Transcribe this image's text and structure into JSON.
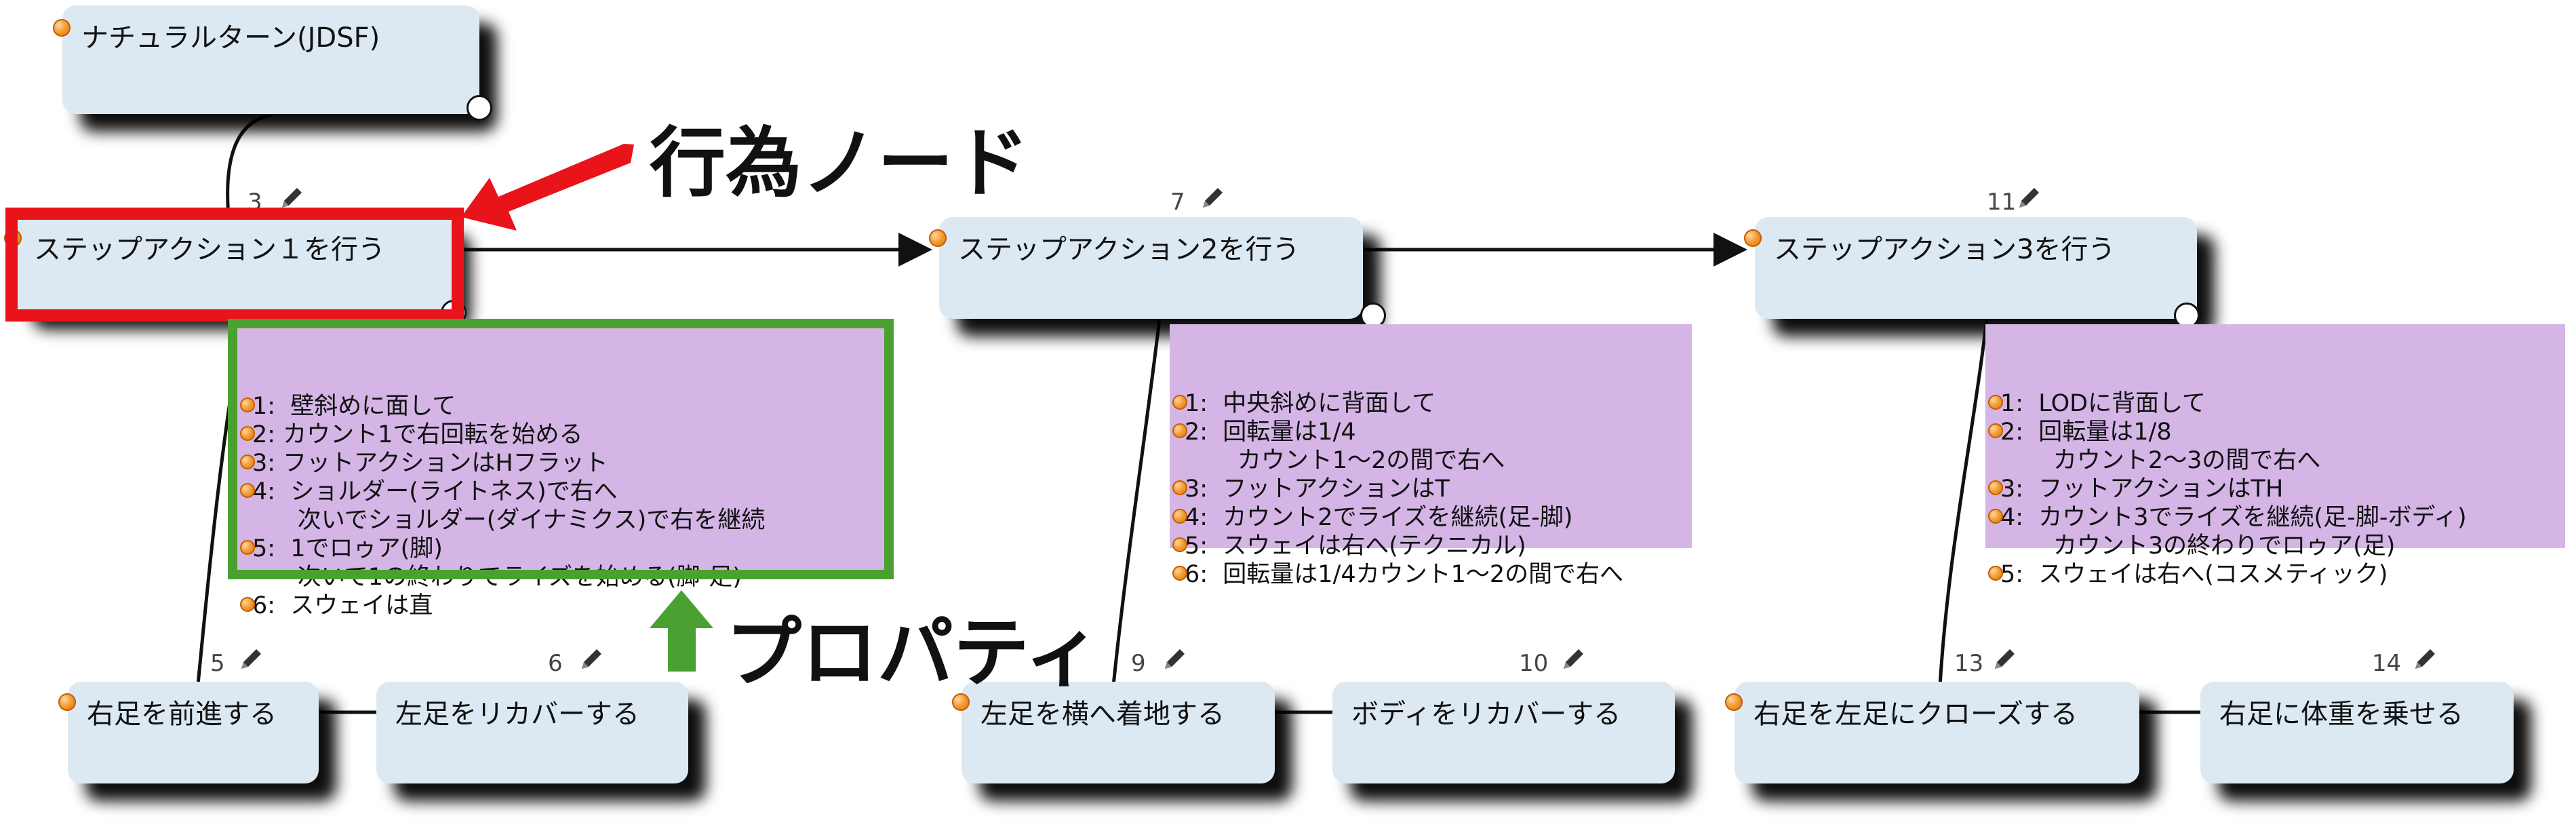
{
  "colors": {
    "node_fill": "#dce9f3",
    "property_fill": "#d4b5e6",
    "highlight_red": "#e8141a",
    "highlight_green": "#4aa132"
  },
  "icons": {
    "node_marker": "orange-bullet-icon",
    "edit": "pencil-icon"
  },
  "root": {
    "label": "ナチュラルターン(JDSF)"
  },
  "actions": [
    {
      "num": "3",
      "label": "ステップアクション１を行う"
    },
    {
      "num": "7",
      "label": "ステップアクション2を行う"
    },
    {
      "num": "11",
      "label": "ステップアクション3を行う"
    }
  ],
  "props": [
    {
      "lines": [
        "1:  壁斜めに面して",
        "2: カウント1で右回転を始める",
        "3: フットアクションはHフラット",
        "4:  ショルダー(ライトネス)で右へ",
        "      次いでショルダー(ダイナミクス)で右を継続",
        "5:  1でロゥア(脚)",
        "      次いで1の終わりでライズを始める(脚-足)",
        "6:  スウェイは直"
      ],
      "bullets": [
        true,
        true,
        true,
        true,
        false,
        true,
        false,
        true
      ]
    },
    {
      "lines": [
        "1:  中央斜めに背面して",
        "2:  回転量は1/4",
        "       カウント1〜2の間で右へ",
        "3:  フットアクションはT",
        "4:  カウント2でライズを継続(足-脚)",
        "5:  スウェイは右へ(テクニカル)",
        "6:  回転量は1/4カウント1〜2の間で右へ"
      ],
      "bullets": [
        true,
        true,
        false,
        true,
        true,
        true,
        true
      ]
    },
    {
      "lines": [
        "1:  LODに背面して",
        "2:  回転量は1/8",
        "       カウント2〜3の間で右へ",
        "3:  フットアクションはTH",
        "4:  カウント3でライズを継続(足-脚-ボディ)",
        "       カウント3の終わりでロゥア(足)",
        "5:  スウェイは右へ(コスメティック)"
      ],
      "bullets": [
        true,
        true,
        false,
        true,
        true,
        false,
        true
      ]
    }
  ],
  "subnodes": [
    {
      "num": "5",
      "label": "右足を前進する"
    },
    {
      "num": "6",
      "label": "左足をリカバーする"
    },
    {
      "num": "9",
      "label": "左足を横へ着地する"
    },
    {
      "num": "10",
      "label": "ボディをリカバーする"
    },
    {
      "num": "13",
      "label": "右足を左足にクローズする"
    },
    {
      "num": "14",
      "label": "右足に体重を乗せる"
    }
  ],
  "annotations": {
    "action_node": "行為ノード",
    "property": "プロパティ"
  }
}
